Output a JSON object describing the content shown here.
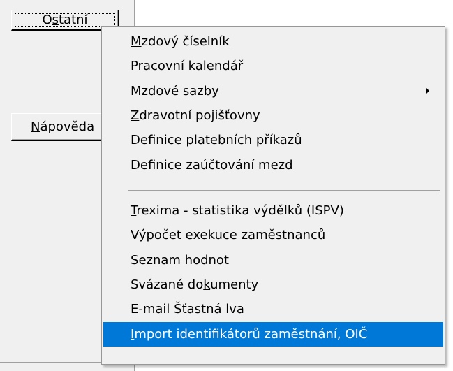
{
  "buttons": {
    "ostatni": {
      "pre": "O",
      "ul": "s",
      "post": "tatní"
    },
    "napoveda": {
      "pre": "",
      "ul": "N",
      "post": "ápověda"
    }
  },
  "menu": {
    "items": [
      {
        "pre": "",
        "ul": "M",
        "post": "zdový číselník",
        "submenu": false,
        "highlighted": false
      },
      {
        "pre": "",
        "ul": "P",
        "post": "racovní kalendář",
        "submenu": false,
        "highlighted": false
      },
      {
        "pre": "Mzdové ",
        "ul": "s",
        "post": "azby",
        "submenu": true,
        "highlighted": false
      },
      {
        "pre": "",
        "ul": "Z",
        "post": "dravotní pojišťovny",
        "submenu": false,
        "highlighted": false
      },
      {
        "pre": "",
        "ul": "D",
        "post": "efinice platebních příkazů",
        "submenu": false,
        "highlighted": false
      },
      {
        "pre": "D",
        "ul": "e",
        "post": "finice zaúčtování mezd",
        "submenu": false,
        "highlighted": false
      },
      {
        "pre": "",
        "ul": "T",
        "post": "rexima - statistika výdělků (ISPV)",
        "submenu": false,
        "highlighted": false
      },
      {
        "pre": "Výpočet e",
        "ul": "x",
        "post": "ekuce zaměstnanců",
        "submenu": false,
        "highlighted": false
      },
      {
        "pre": "",
        "ul": "S",
        "post": "eznam hodnot",
        "submenu": false,
        "highlighted": false
      },
      {
        "pre": "Svázané do",
        "ul": "k",
        "post": "umenty",
        "submenu": false,
        "highlighted": false
      },
      {
        "pre": "",
        "ul": "E",
        "post": "-mail Šťastná lva",
        "submenu": false,
        "highlighted": false
      },
      {
        "pre": "",
        "ul": "I",
        "post": "mport identifikátorů zaměstnání, OIČ",
        "submenu": false,
        "highlighted": true
      }
    ]
  },
  "colors": {
    "highlight_bg": "#0078d7",
    "highlight_fg": "#ffffff",
    "menu_bg": "#f0f0f0"
  },
  "icons": {
    "submenu": "triangle-right-icon"
  }
}
